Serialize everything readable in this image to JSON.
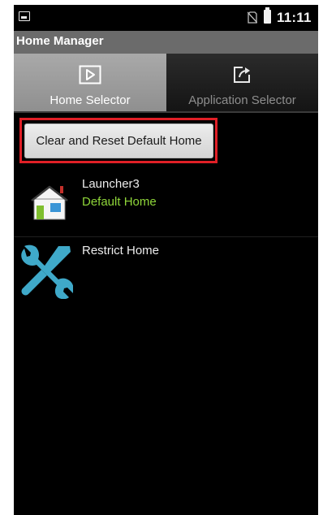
{
  "status_bar": {
    "time": "11:11",
    "icons": [
      "image-notification-icon",
      "no-sim-icon",
      "battery-icon"
    ]
  },
  "app": {
    "title": "Home Manager"
  },
  "tabs": [
    {
      "label": "Home Selector",
      "icon": "play-box-icon",
      "selected": true
    },
    {
      "label": "Application Selector",
      "icon": "share-arrow-icon",
      "selected": false
    }
  ],
  "actions": {
    "reset_label": "Clear and Reset Default Home"
  },
  "apps": [
    {
      "name": "Launcher3",
      "subtitle": "Default Home",
      "icon": "house-icon"
    },
    {
      "name": "Restrict Home",
      "subtitle": "",
      "icon": "tools-icon"
    }
  ],
  "colors": {
    "highlight": "#e01f26",
    "default_home_text": "#8fd63a",
    "title_bar": "#6b6b6b",
    "tool_icon": "#3fa9c9"
  }
}
